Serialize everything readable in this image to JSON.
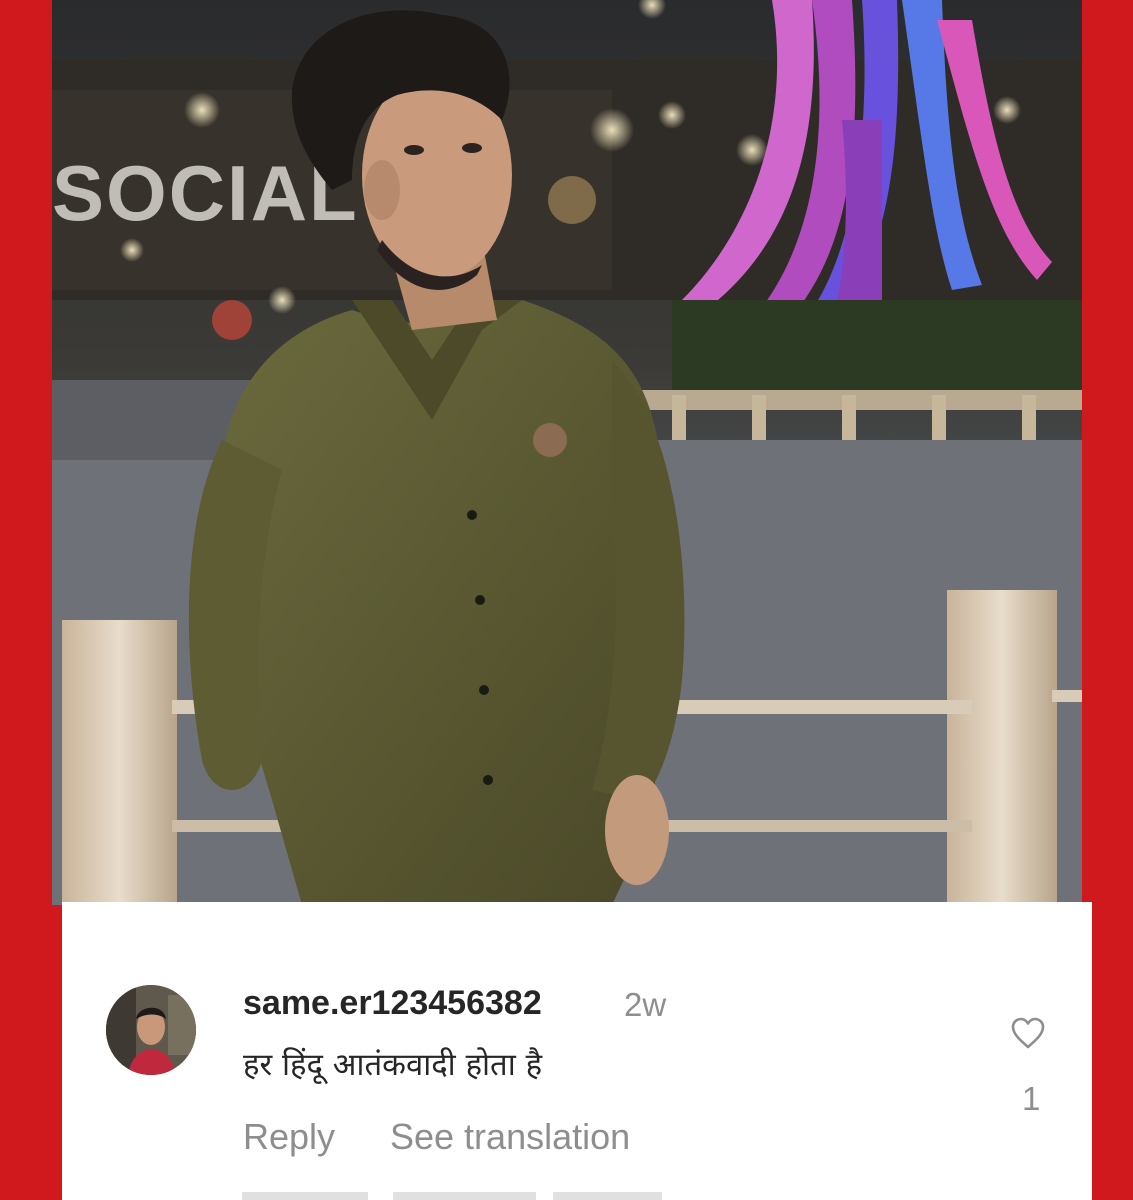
{
  "photo": {
    "sign_text": "SOCIAL"
  },
  "comment": {
    "username": "same.er123456382",
    "timestamp": "2w",
    "text": "हर हिंदू आतंकवादी होता है",
    "reply_label": "Reply",
    "translate_label": "See translation",
    "like_count": "1",
    "like_icon": "heart-outline-icon"
  },
  "colors": {
    "frame_red": "#d0191d",
    "card_bg": "#ffffff",
    "username": "#262626",
    "muted": "#8e8e8e"
  }
}
